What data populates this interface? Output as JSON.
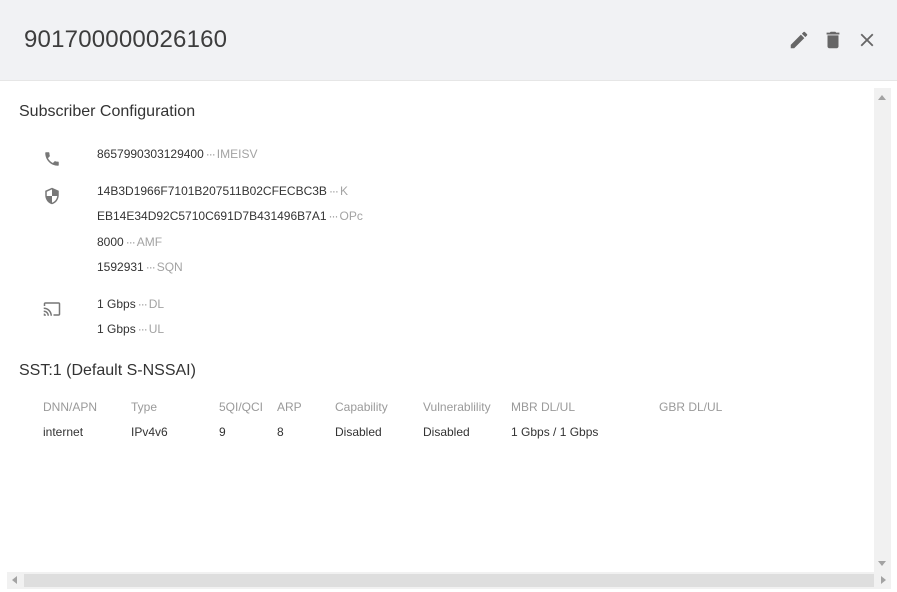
{
  "header": {
    "title": "901700000026160",
    "actions": {
      "edit": "edit-icon",
      "delete": "delete-icon",
      "close": "close-icon"
    }
  },
  "subscriber": {
    "title": "Subscriber Configuration",
    "groups": [
      {
        "icon": "phone-icon",
        "rows": [
          {
            "value": "8657990303129400",
            "label": "IMEISV"
          }
        ]
      },
      {
        "icon": "shield-icon",
        "rows": [
          {
            "value": "14B3D1966F7101B207511B02CFECBC3B",
            "label": "K"
          },
          {
            "value": "EB14E34D92C5710C691D7B431496B7A1",
            "label": "OPc"
          },
          {
            "value": "8000",
            "label": "AMF"
          },
          {
            "value": "1592931",
            "label": "SQN"
          }
        ]
      },
      {
        "icon": "cast-icon",
        "rows": [
          {
            "value": "1 Gbps",
            "label": "DL"
          },
          {
            "value": "1 Gbps",
            "label": "UL"
          }
        ]
      }
    ]
  },
  "slice": {
    "title": "SST:1 (Default S-NSSAI)",
    "columns": [
      "DNN/APN",
      "Type",
      "5QI/QCI",
      "ARP",
      "Capability",
      "Vulnerablility",
      "MBR DL/UL",
      "GBR DL/UL"
    ],
    "rows": [
      [
        "internet",
        "IPv4v6",
        "9",
        "8",
        "Disabled",
        "Disabled",
        "1 Gbps / 1 Gbps",
        ""
      ]
    ]
  },
  "dots": "···"
}
